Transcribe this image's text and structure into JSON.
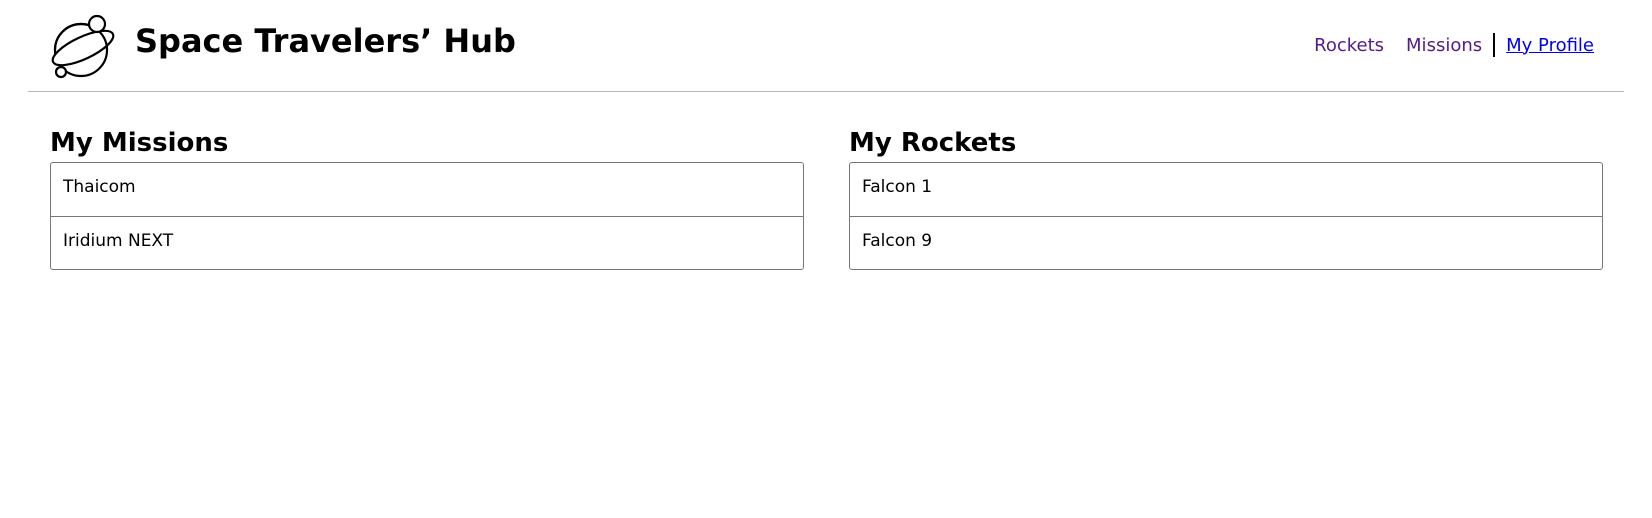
{
  "header": {
    "title": "Space Travelers’ Hub",
    "logo_icon": "planet-icon",
    "nav": {
      "rockets": "Rockets",
      "missions": "Missions",
      "profile": "My Profile"
    }
  },
  "missions": {
    "heading": "My Missions",
    "items": [
      "Thaicom",
      "Iridium NEXT"
    ]
  },
  "rockets": {
    "heading": "My Rockets",
    "items": [
      "Falcon 1",
      "Falcon 9"
    ]
  },
  "colors": {
    "visited_link": "#551a8b",
    "active_link": "#0000ee",
    "border": "#777777"
  }
}
